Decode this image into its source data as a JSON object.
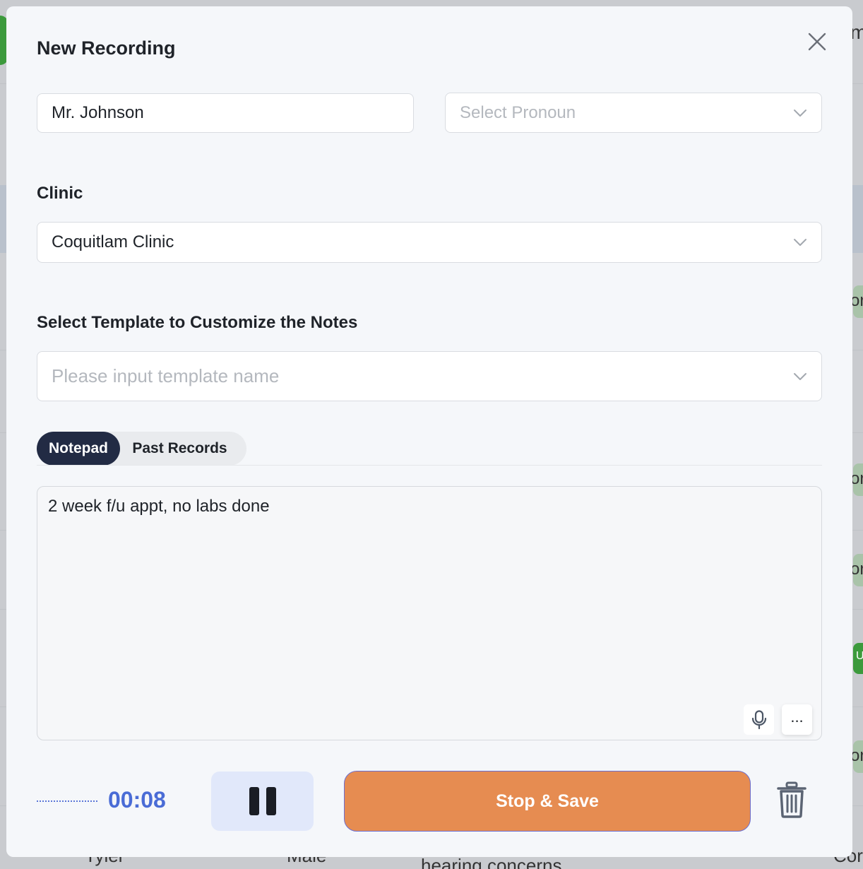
{
  "background": {
    "fragments": [
      "m",
      "or",
      "or",
      "or",
      "U",
      "or",
      "Cor",
      "Tyler",
      "Male",
      "hearing concerns"
    ]
  },
  "modal": {
    "title": "New Recording",
    "close_icon": "close-icon"
  },
  "patient": {
    "name_value": "Mr. Johnson",
    "pronoun_placeholder": "Select Pronoun"
  },
  "clinic": {
    "label": "Clinic",
    "selected": "Coquitlam Clinic"
  },
  "template": {
    "label": "Select Template to Customize the Notes",
    "placeholder": "Please input template name"
  },
  "tabs": [
    {
      "label": "Notepad",
      "active": true
    },
    {
      "label": "Past Records",
      "active": false
    }
  ],
  "notepad": {
    "text": "2 week f/u appt, no labs done",
    "mic_icon": "microphone-icon",
    "more_label": "..."
  },
  "recording": {
    "timer": "00:08",
    "pause_icon": "pause-icon",
    "stop_label": "Stop & Save",
    "trash_icon": "trash-icon"
  },
  "colors": {
    "primary_dark": "#222b44",
    "accent_blue": "#4a6cd6",
    "stop_orange": "#e68c51",
    "pause_bg": "#e1e8fa"
  }
}
